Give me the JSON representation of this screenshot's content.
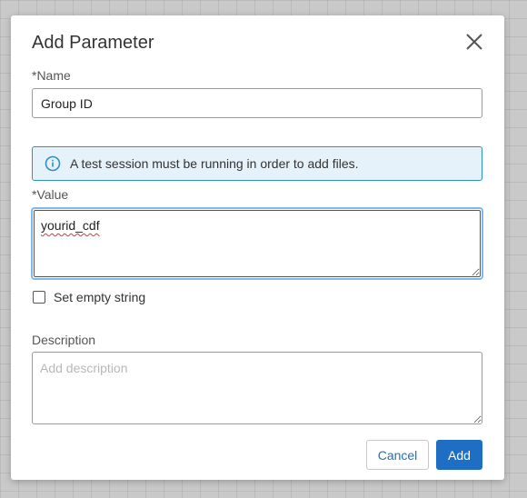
{
  "dialog": {
    "title": "Add Parameter",
    "close_icon": "close-icon"
  },
  "name_field": {
    "label": "*Name",
    "value": "Group ID"
  },
  "info_banner": {
    "icon": "info-icon",
    "text": "A test session must be running in order to add files.",
    "border_color": "#2e8fc9",
    "background_color": "#e6f2fa"
  },
  "value_field": {
    "label": "*Value",
    "value": "yourid_cdf",
    "focus_color": "#7fb8ea"
  },
  "empty_string_checkbox": {
    "label": "Set empty string",
    "checked": false
  },
  "description_field": {
    "label": "Description",
    "value": "",
    "placeholder": "Add description"
  },
  "buttons": {
    "cancel_label": "Cancel",
    "add_label": "Add",
    "accent_color": "#1e6fc4"
  }
}
